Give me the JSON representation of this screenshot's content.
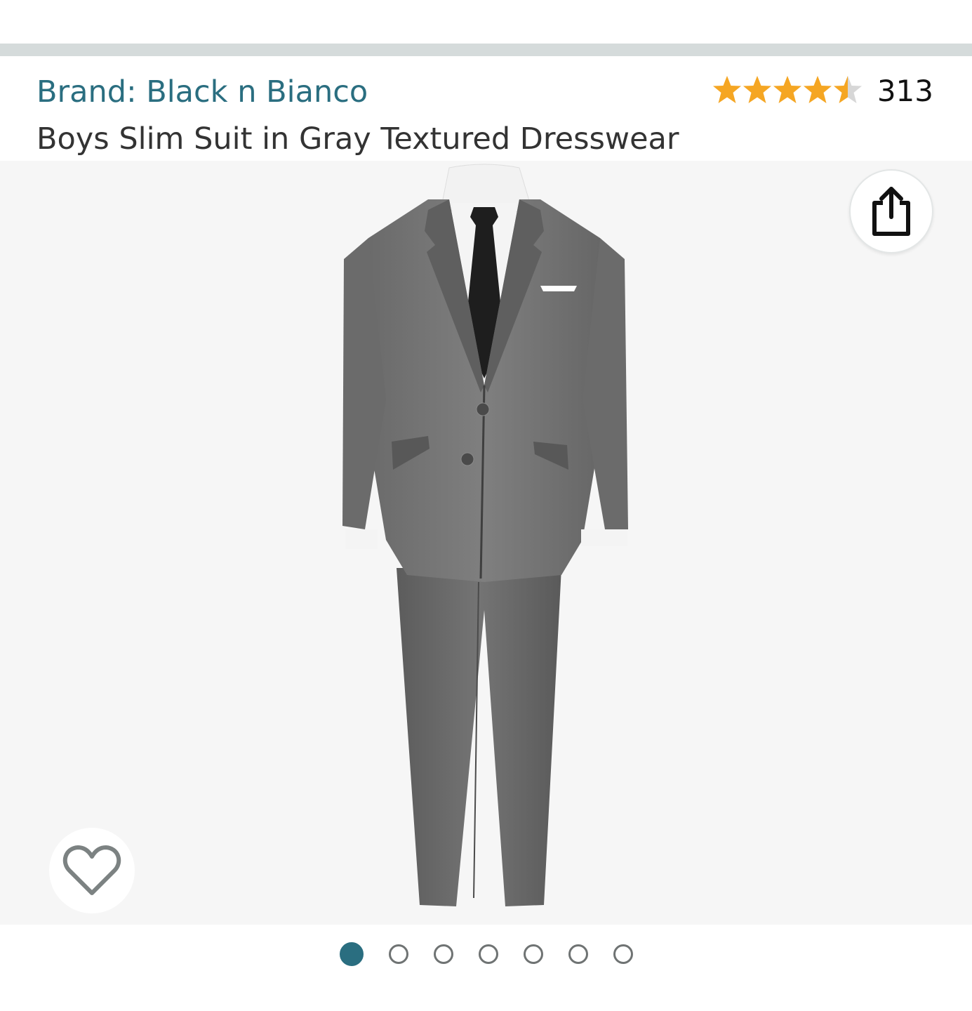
{
  "brand": {
    "label": "Brand: Black n Bianco"
  },
  "rating": {
    "stars": 4.5,
    "max_stars": 5,
    "review_count": "313",
    "star_color": "#f5a623",
    "empty_star_color": "#d7d7d7"
  },
  "product": {
    "title": "Boys Slim Suit in Gray Textured Dresswear"
  },
  "image_carousel": {
    "image_count": 7,
    "active_index": 0,
    "accent": "#2a6e80"
  },
  "actions": {
    "share_icon": "share-icon",
    "wishlist_icon": "heart-icon"
  }
}
